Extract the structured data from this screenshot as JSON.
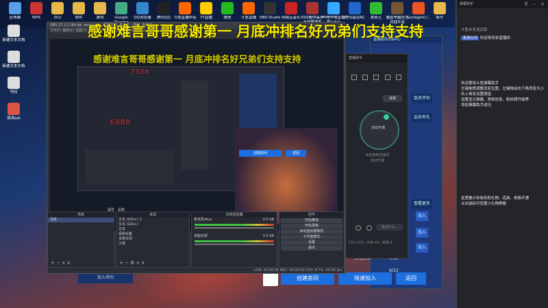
{
  "desktop": {
    "top_icons": [
      {
        "label": "此电脑",
        "icon": "computer-icon",
        "color": "#5aa0e8"
      },
      {
        "label": "WPS",
        "icon": "wps-icon",
        "color": "#c33"
      },
      {
        "label": "办公",
        "icon": "folder-icon",
        "color": "#e8b84a"
      },
      {
        "label": "软件",
        "icon": "folder-icon",
        "color": "#e8b84a"
      },
      {
        "label": "游戏",
        "icon": "folder-icon",
        "color": "#e8b84a"
      },
      {
        "label": "Google Chrome",
        "icon": "chrome-icon",
        "color": "#4a8"
      },
      {
        "label": "QQ浏览器",
        "icon": "qqbrowser-icon",
        "color": "#38c"
      },
      {
        "label": "腾讯QQ",
        "icon": "qq-icon",
        "color": "#222"
      },
      {
        "label": "斗鱼直播伴侣",
        "icon": "douyu-icon",
        "color": "#f60"
      },
      {
        "label": "YY直播",
        "icon": "yy-icon",
        "color": "#fc0"
      },
      {
        "label": "微信",
        "icon": "wechat-icon",
        "color": "#2b2"
      },
      {
        "label": "斗鱼直播",
        "icon": "douyu-icon",
        "color": "#f60"
      },
      {
        "label": "OBS Studio",
        "icon": "obs-icon",
        "color": "#333"
      },
      {
        "label": "网易云音乐",
        "icon": "music-icon",
        "color": "#c22"
      },
      {
        "label": "KSS看你需多卡创意插件",
        "icon": "kss-icon",
        "color": "#a33"
      },
      {
        "label": "哔哩哔哩直播姬(x64)",
        "icon": "bili-icon",
        "color": "#3af"
      },
      {
        "label": "腾讯会议RC",
        "icon": "meeting-icon",
        "color": "#26c"
      },
      {
        "label": "爱奇艺",
        "icon": "iqiyi-icon",
        "color": "#3b3"
      },
      {
        "label": "魔兽争霸官方对战平台",
        "icon": "warcraft-icon",
        "color": "#753"
      },
      {
        "label": "SunloginCl...",
        "icon": "sunlogin-icon",
        "color": "#e52"
      },
      {
        "label": "新开",
        "icon": "folder-icon",
        "color": "#e8b84a"
      }
    ],
    "left_icons": [
      {
        "label": "新建文本文档",
        "icon": "txt-icon",
        "color": "#ddd"
      },
      {
        "label": "新建文本文档",
        "icon": "txt-icon",
        "color": "#ddd"
      },
      {
        "label": "号码",
        "icon": "doc-icon",
        "color": "#ddd"
      },
      {
        "label": "演讲ppt",
        "icon": "ppt-icon",
        "color": "#d54"
      }
    ]
  },
  "overlays": {
    "scroll_main": "感谢难言哥哥感谢第一 月底冲排名好兄弟们支持支持",
    "scroll_second": "感谢难言哥哥感谢第一 月底冲排名好兄弟们支持支持",
    "ghost_1": "7538",
    "ghost_2": "6888"
  },
  "obs": {
    "title": "OBS 27.2.1 (64-bit, windows) - 配置文件: 未命名 - 场景: 未命名",
    "menu": "文件(F)  编辑(E)  视图(V)  停靠部件(D)  配置文件(P)  场景集合(S)  工具(T)  帮助(H)",
    "scenes_header": "来源",
    "sources_header": "来源",
    "scene_label": "场景",
    "sources": [
      "文本 (GDI+) 2",
      "文本 (GDI+)",
      "文本",
      "视频采集",
      "多数关闭",
      "火锅"
    ],
    "mixer_header": "音频混音器",
    "mixer_tracks": [
      {
        "label": "麦克风/Aux",
        "value": "0.0 dB"
      },
      {
        "label": "桌面音频",
        "value": "0.0 dB"
      }
    ],
    "controls_header": "控件",
    "controls": [
      "开始推流",
      "开始录制",
      "启动虚拟摄像机",
      "工作室模式",
      "设置",
      "退出"
    ],
    "filters_btn": "属性",
    "filters_btn2": "滤镜",
    "status": "LIVE: 00:00:00    REC: 00:00:00    CPU: 8.7%, 60.00 fps"
  },
  "assistant": {
    "top_label": "直播助手",
    "connect": "连接",
    "helper_title": "自动开播",
    "helper_sub1": "未连接到直播间",
    "helper_sub2": "自动开播",
    "input_placeholder": "说点什么...",
    "stats": [
      "CPU:15%",
      "内存:4%",
      "帧率:9"
    ]
  },
  "room": {
    "header": "直播房间详情中心",
    "labels": [
      "会员评价",
      "会员有礼",
      "查看更多"
    ],
    "rows": [
      {
        "name": "加入"
      },
      {
        "name": "加入"
      },
      {
        "name": "加入"
      }
    ],
    "slot_1": "聊着之绿",
    "slot_1_count": "9/12",
    "slot_2": "9/12",
    "join_bottom": "加入房间",
    "buttons": {
      "create": "创建房间",
      "quick": "快速加入",
      "back": "返回"
    }
  },
  "chat": {
    "window_title": "弹幕助手",
    "welcome_line": "欢迎来到本直播间",
    "user_line": "清清拉闷",
    "notice_1": "斗鱼未发送消息",
    "help_lines": [
      "欢迎使用斗鱼弹幕助手",
      "左键拖拽调整改变位置，左键拖动右下角改变大小",
      "右上角有设置按钮",
      "设置显示弹幕、贵族信息、粉丝牌升级等",
      "添加弹幕助手成功"
    ],
    "tip_lines": [
      "这里展示你收到的礼物、道具、贵族开通",
      "点击鼠标可设置小礼物屏蔽"
    ]
  },
  "colors": {
    "accent_blue": "#1d6fe0",
    "overlay_yellow": "#f4e800",
    "obs_bg": "#2b2e38"
  }
}
